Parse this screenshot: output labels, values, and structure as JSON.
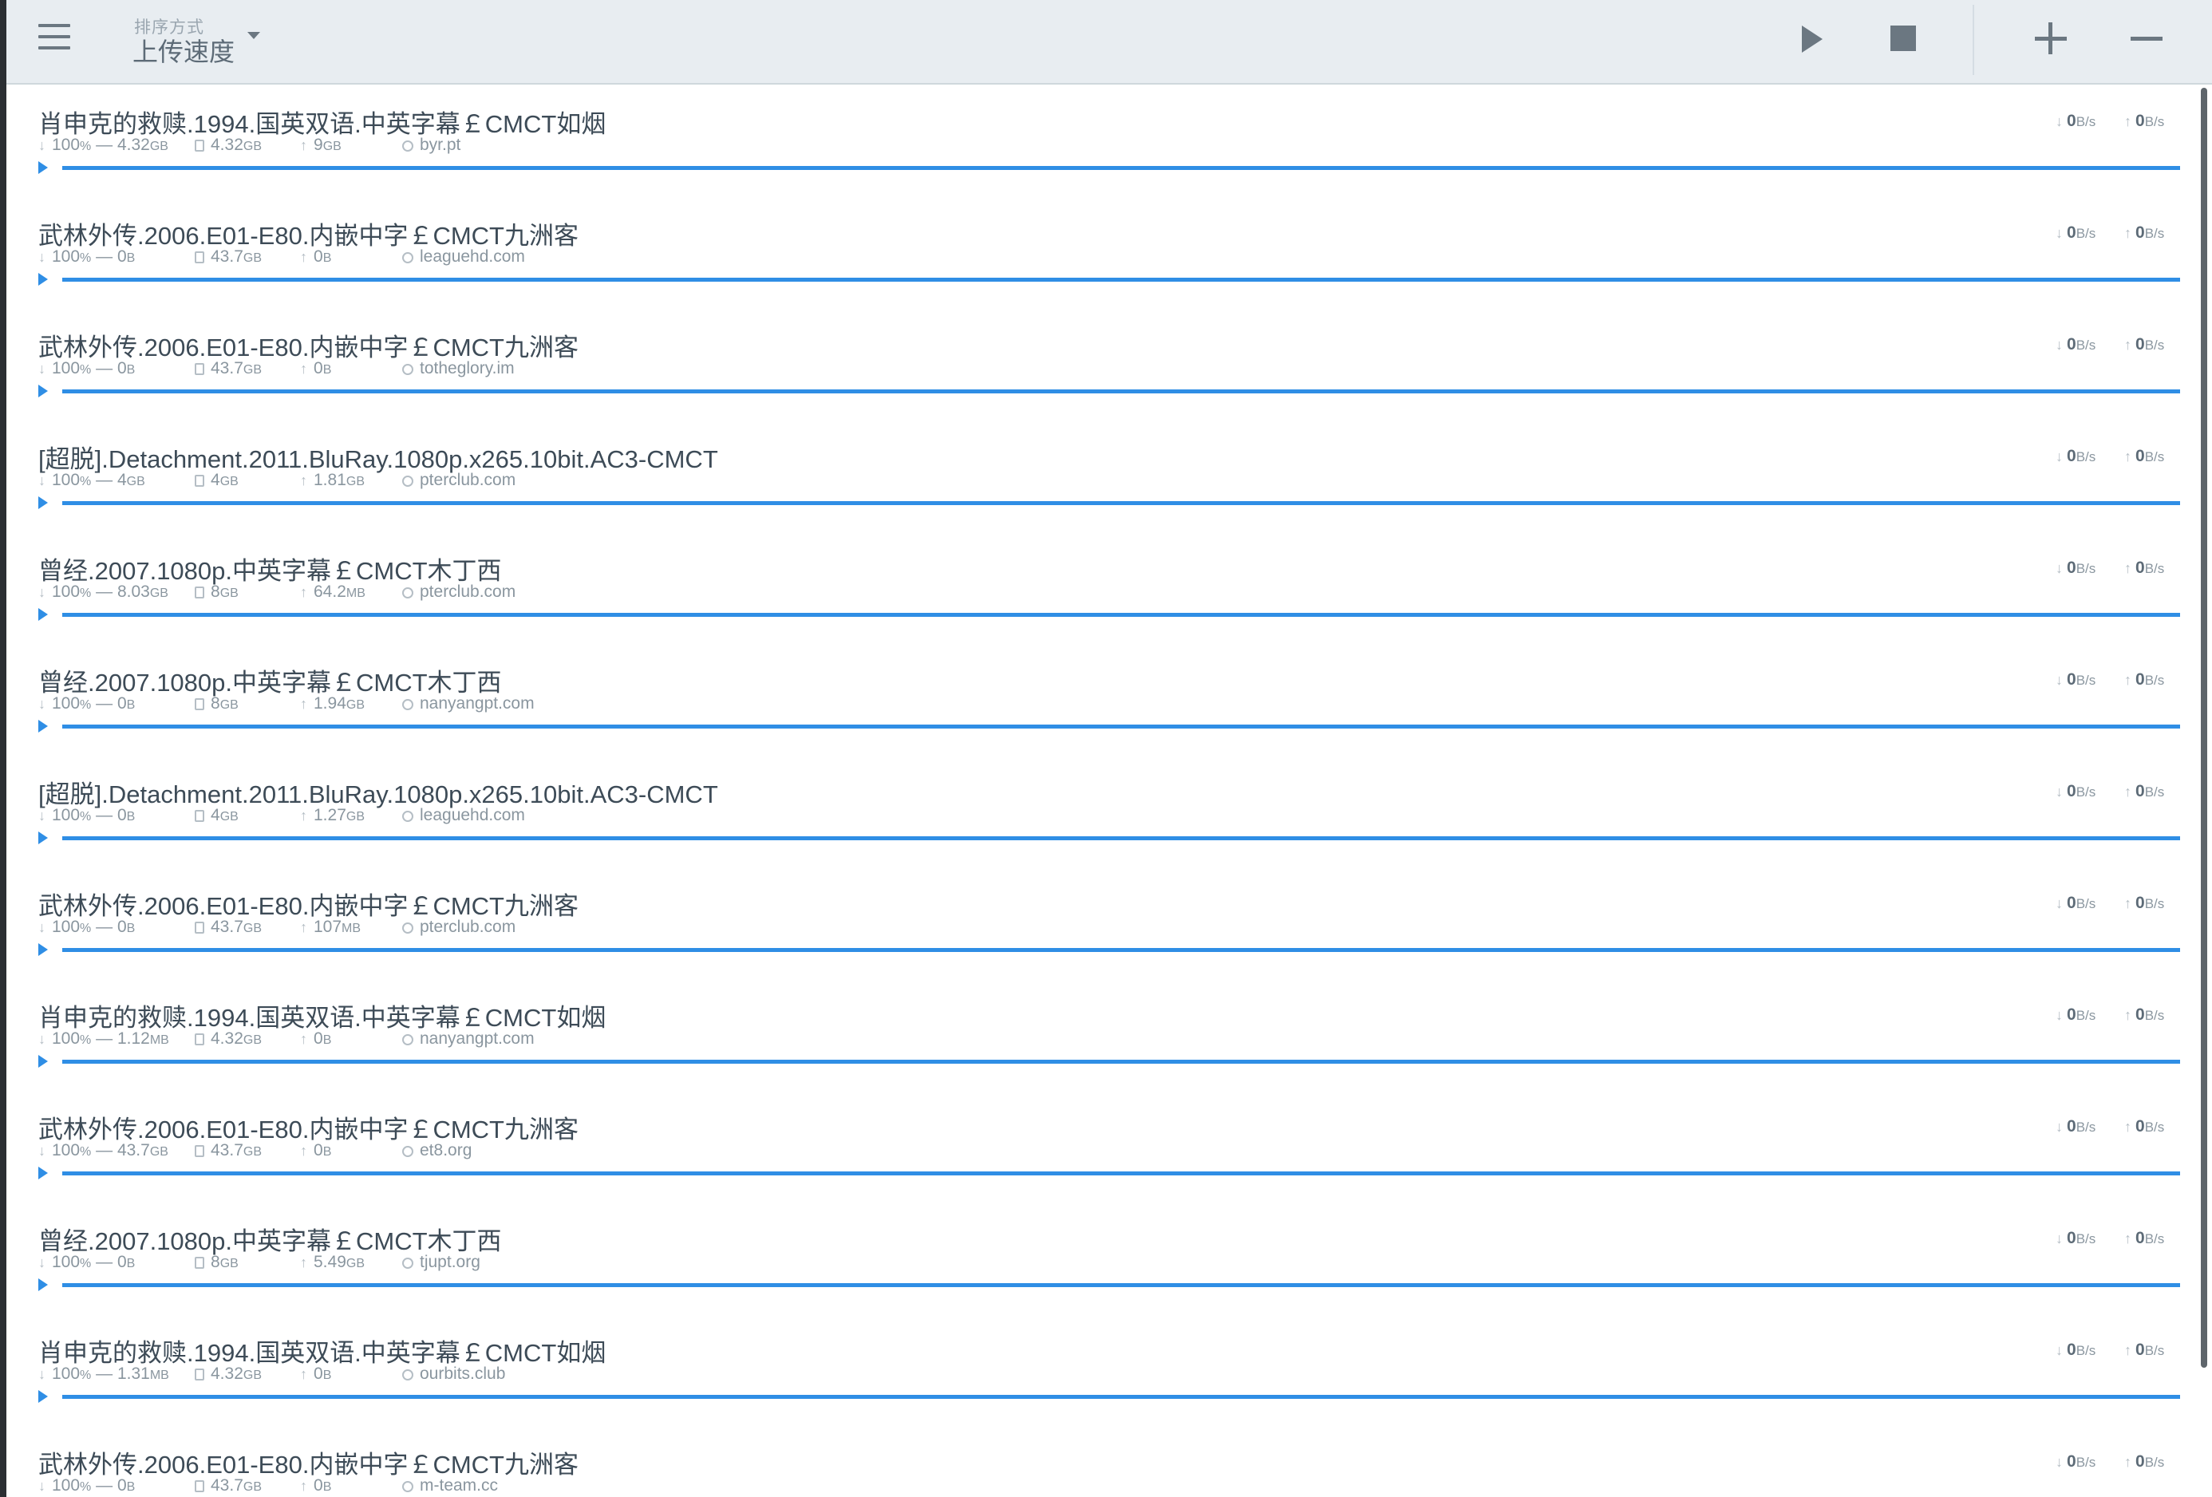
{
  "toolbar": {
    "sort_caption": "排序方式",
    "sort_value": "上传速度",
    "icons": {
      "menu": "hamburger-menu-icon",
      "sort": "caret-down-icon",
      "start": "play-icon",
      "stop": "stop-icon",
      "add": "plus-icon",
      "remove": "minus-icon"
    }
  },
  "colors": {
    "accent": "#2f8ee5",
    "toolbar_bg": "#e8edf1",
    "text": "#3d4b57",
    "muted": "#8a969f"
  },
  "torrents": [
    {
      "name": "肖申克的救赎.1994.国英双语.中英字幕￡CMCT如烟",
      "done_pct": "100",
      "done_unit": "%",
      "remaining": "4.32",
      "remaining_unit": "GB",
      "size": "4.32",
      "size_unit": "GB",
      "uploaded": "9",
      "uploaded_unit": "GB",
      "tracker": "byr.pt",
      "down_rate": "0",
      "up_rate": "0",
      "rate_unit": "B/s",
      "progress": 1.0
    },
    {
      "name": "武林外传.2006.E01-E80.内嵌中字￡CMCT九洲客",
      "done_pct": "100",
      "done_unit": "%",
      "remaining": "0",
      "remaining_unit": "B",
      "size": "43.7",
      "size_unit": "GB",
      "uploaded": "0",
      "uploaded_unit": "B",
      "tracker": "leaguehd.com",
      "down_rate": "0",
      "up_rate": "0",
      "rate_unit": "B/s",
      "progress": 1.0
    },
    {
      "name": "武林外传.2006.E01-E80.内嵌中字￡CMCT九洲客",
      "done_pct": "100",
      "done_unit": "%",
      "remaining": "0",
      "remaining_unit": "B",
      "size": "43.7",
      "size_unit": "GB",
      "uploaded": "0",
      "uploaded_unit": "B",
      "tracker": "totheglory.im",
      "down_rate": "0",
      "up_rate": "0",
      "rate_unit": "B/s",
      "progress": 1.0
    },
    {
      "name": "[超脱].Detachment.2011.BluRay.1080p.x265.10bit.AC3-CMCT",
      "done_pct": "100",
      "done_unit": "%",
      "remaining": "4",
      "remaining_unit": "GB",
      "size": "4",
      "size_unit": "GB",
      "uploaded": "1.81",
      "uploaded_unit": "GB",
      "tracker": "pterclub.com",
      "down_rate": "0",
      "up_rate": "0",
      "rate_unit": "B/s",
      "progress": 1.0
    },
    {
      "name": "曾经.2007.1080p.中英字幕￡CMCT木丁西",
      "done_pct": "100",
      "done_unit": "%",
      "remaining": "8.03",
      "remaining_unit": "GB",
      "size": "8",
      "size_unit": "GB",
      "uploaded": "64.2",
      "uploaded_unit": "MB",
      "tracker": "pterclub.com",
      "down_rate": "0",
      "up_rate": "0",
      "rate_unit": "B/s",
      "progress": 1.0
    },
    {
      "name": "曾经.2007.1080p.中英字幕￡CMCT木丁西",
      "done_pct": "100",
      "done_unit": "%",
      "remaining": "0",
      "remaining_unit": "B",
      "size": "8",
      "size_unit": "GB",
      "uploaded": "1.94",
      "uploaded_unit": "GB",
      "tracker": "nanyangpt.com",
      "down_rate": "0",
      "up_rate": "0",
      "rate_unit": "B/s",
      "progress": 1.0
    },
    {
      "name": "[超脱].Detachment.2011.BluRay.1080p.x265.10bit.AC3-CMCT",
      "done_pct": "100",
      "done_unit": "%",
      "remaining": "0",
      "remaining_unit": "B",
      "size": "4",
      "size_unit": "GB",
      "uploaded": "1.27",
      "uploaded_unit": "GB",
      "tracker": "leaguehd.com",
      "down_rate": "0",
      "up_rate": "0",
      "rate_unit": "B/s",
      "progress": 1.0
    },
    {
      "name": "武林外传.2006.E01-E80.内嵌中字￡CMCT九洲客",
      "done_pct": "100",
      "done_unit": "%",
      "remaining": "0",
      "remaining_unit": "B",
      "size": "43.7",
      "size_unit": "GB",
      "uploaded": "107",
      "uploaded_unit": "MB",
      "tracker": "pterclub.com",
      "down_rate": "0",
      "up_rate": "0",
      "rate_unit": "B/s",
      "progress": 1.0
    },
    {
      "name": "肖申克的救赎.1994.国英双语.中英字幕￡CMCT如烟",
      "done_pct": "100",
      "done_unit": "%",
      "remaining": "1.12",
      "remaining_unit": "MB",
      "size": "4.32",
      "size_unit": "GB",
      "uploaded": "0",
      "uploaded_unit": "B",
      "tracker": "nanyangpt.com",
      "down_rate": "0",
      "up_rate": "0",
      "rate_unit": "B/s",
      "progress": 1.0
    },
    {
      "name": "武林外传.2006.E01-E80.内嵌中字￡CMCT九洲客",
      "done_pct": "100",
      "done_unit": "%",
      "remaining": "43.7",
      "remaining_unit": "GB",
      "size": "43.7",
      "size_unit": "GB",
      "uploaded": "0",
      "uploaded_unit": "B",
      "tracker": "et8.org",
      "down_rate": "0",
      "up_rate": "0",
      "rate_unit": "B/s",
      "progress": 1.0
    },
    {
      "name": "曾经.2007.1080p.中英字幕￡CMCT木丁西",
      "done_pct": "100",
      "done_unit": "%",
      "remaining": "0",
      "remaining_unit": "B",
      "size": "8",
      "size_unit": "GB",
      "uploaded": "5.49",
      "uploaded_unit": "GB",
      "tracker": "tjupt.org",
      "down_rate": "0",
      "up_rate": "0",
      "rate_unit": "B/s",
      "progress": 1.0
    },
    {
      "name": "肖申克的救赎.1994.国英双语.中英字幕￡CMCT如烟",
      "done_pct": "100",
      "done_unit": "%",
      "remaining": "1.31",
      "remaining_unit": "MB",
      "size": "4.32",
      "size_unit": "GB",
      "uploaded": "0",
      "uploaded_unit": "B",
      "tracker": "ourbits.club",
      "down_rate": "0",
      "up_rate": "0",
      "rate_unit": "B/s",
      "progress": 1.0
    },
    {
      "name": "武林外传.2006.E01-E80.内嵌中字￡CMCT九洲客",
      "done_pct": "100",
      "done_unit": "%",
      "remaining": "0",
      "remaining_unit": "B",
      "size": "43.7",
      "size_unit": "GB",
      "uploaded": "0",
      "uploaded_unit": "B",
      "tracker": "m-team.cc",
      "down_rate": "0",
      "up_rate": "0",
      "rate_unit": "B/s",
      "progress": 1.0
    }
  ]
}
